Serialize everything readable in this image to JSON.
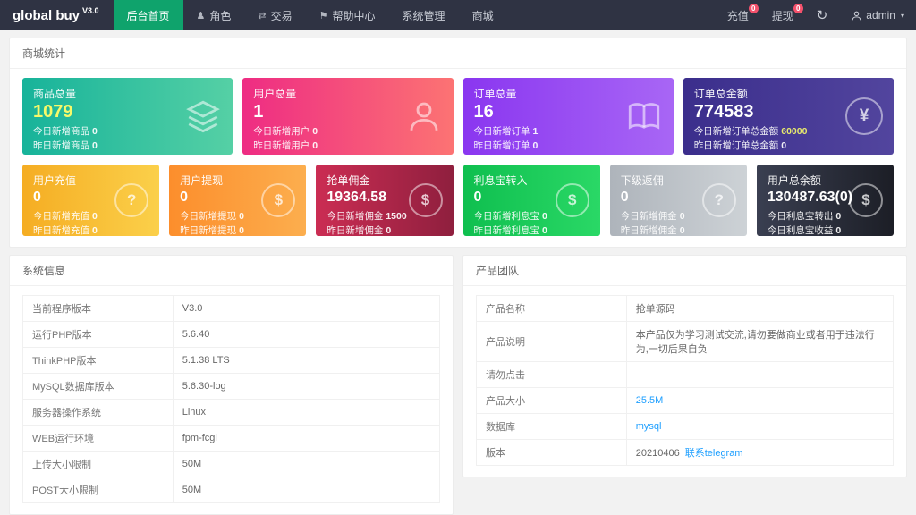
{
  "brand": {
    "name": "global buy",
    "version": "V3.0"
  },
  "nav": {
    "items": [
      {
        "label": "后台首页",
        "icon": ""
      },
      {
        "label": "角色",
        "icon": "role-icon"
      },
      {
        "label": "交易",
        "icon": "trade-icon"
      },
      {
        "label": "帮助中心",
        "icon": "flag-icon"
      },
      {
        "label": "系统管理",
        "icon": ""
      },
      {
        "label": "商城",
        "icon": ""
      }
    ],
    "icon_glyphs": {
      "role": "♟",
      "trade": "⇄",
      "flag": "⚑"
    }
  },
  "topbar_right": {
    "recharge_label": "充值",
    "recharge_badge": "0",
    "withdraw_label": "提现",
    "withdraw_badge": "0",
    "refresh_icon": "refresh-icon",
    "admin_label": "admin",
    "caret": "▾"
  },
  "colors": {
    "navbar_bg": "#2f3343",
    "nav_active_bg": "#0fa36c",
    "badge_bg": "#f4516c",
    "link_blue": "#1e9fff",
    "page_bg": "#f2f2f2"
  },
  "sections": {
    "stats_title": "商城统计"
  },
  "stats_row1": [
    {
      "title": "商品总量",
      "value": "1079",
      "value_color": "#f6f96a",
      "line1_label": "今日新增商品",
      "line1_value": "0",
      "line2_label": "昨日新增商品",
      "line2_value": "0",
      "from": "#17b39a",
      "to": "#55d0a5",
      "icon": "layers-icon"
    },
    {
      "title": "用户总量",
      "value": "1",
      "line1_label": "今日新增用户",
      "line1_value": "0",
      "line2_label": "昨日新增用户",
      "line2_value": "0",
      "from": "#ee2c83",
      "to": "#fc7373",
      "icon": "user-icon"
    },
    {
      "title": "订单总量",
      "value": "16",
      "line1_label": "今日新增订单",
      "line1_value": "1",
      "line2_label": "昨日新增订单",
      "line2_value": "0",
      "from": "#8a36f0",
      "to": "#a866f5",
      "icon": "book-icon"
    },
    {
      "title": "订单总金额",
      "value": "774583",
      "line1_value_color": "#f6f96a",
      "line1_label": "今日新增订单总金额",
      "line1_value": "60000",
      "line2_label": "昨日新增订单总金额",
      "line2_value": "0",
      "from": "#3b2e8c",
      "to": "#52459e",
      "icon": "yen-icon",
      "icon_glyph": "¥"
    }
  ],
  "stats_row2": [
    {
      "title": "用户充值",
      "value": "0",
      "line1_label": "今日新增充值",
      "line1_value": "0",
      "line2_label": "昨日新增充值",
      "line2_value": "0",
      "from": "#f5ad23",
      "to": "#fbd04a",
      "icon": "question-icon",
      "icon_glyph": "?"
    },
    {
      "title": "用户提现",
      "value": "0",
      "line1_label": "今日新增提现",
      "line1_value": "0",
      "line2_label": "昨日新增提现",
      "line2_value": "0",
      "from": "#fc8e2c",
      "to": "#fcae4e",
      "icon": "dollar-icon",
      "icon_glyph": "$"
    },
    {
      "title": "抢单佣金",
      "value": "19364.58",
      "line1_label": "今日新增佣金",
      "line1_value": "1500",
      "line2_label": "昨日新增佣金",
      "line2_value": "0",
      "from": "#cb2d53",
      "to": "#8f1f3e",
      "icon": "dollar-icon",
      "icon_glyph": "$"
    },
    {
      "title": "利息宝转入",
      "value": "0",
      "line1_label": "今日新增利息宝",
      "line1_value": "0",
      "line2_label": "昨日新增利息宝",
      "line2_value": "0",
      "from": "#0fbf4f",
      "to": "#2ad866",
      "icon": "dollar-icon",
      "icon_glyph": "$"
    },
    {
      "title": "下级返佣",
      "value": "0",
      "line1_label": "今日新增佣金",
      "line1_value": "0",
      "line2_label": "昨日新增佣金",
      "line2_value": "0",
      "from": "#aeb4bb",
      "to": "#cdd2d6",
      "icon": "question-icon",
      "icon_glyph": "?"
    },
    {
      "title": "用户总余额",
      "value": "130487.63(0)",
      "line1_label": "今日利息宝转出",
      "line1_value": "0",
      "line2_label": "今日利息宝收益",
      "line2_value": "0",
      "from": "#3a3f51",
      "to": "#1c1e26",
      "icon": "dollar-icon",
      "icon_glyph": "$"
    }
  ],
  "system_info": {
    "title": "系统信息",
    "rows": [
      {
        "label": "当前程序版本",
        "value": "V3.0"
      },
      {
        "label": "运行PHP版本",
        "value": "5.6.40"
      },
      {
        "label": "ThinkPHP版本",
        "value": "5.1.38 LTS"
      },
      {
        "label": "MySQL数据库版本",
        "value": "5.6.30-log"
      },
      {
        "label": "服务器操作系统",
        "value": "Linux"
      },
      {
        "label": "WEB运行环境",
        "value": "fpm-fcgi"
      },
      {
        "label": "上传大小限制",
        "value": "50M"
      },
      {
        "label": "POST大小限制",
        "value": "50M"
      }
    ]
  },
  "product_team": {
    "title": "产品团队",
    "rows": [
      {
        "label": "产品名称",
        "value": "抢单源码"
      },
      {
        "label": "产品说明",
        "value": "本产品仅为学习测试交流,请勿要做商业或者用于违法行为,一切后果自负"
      },
      {
        "label": "请勿点击",
        "value": ""
      },
      {
        "label": "产品大小",
        "value": "25.5M"
      },
      {
        "label": "数据库",
        "value": "mysql"
      },
      {
        "label": "版本",
        "value": "20210406",
        "link_text": "联系telegram"
      }
    ]
  }
}
